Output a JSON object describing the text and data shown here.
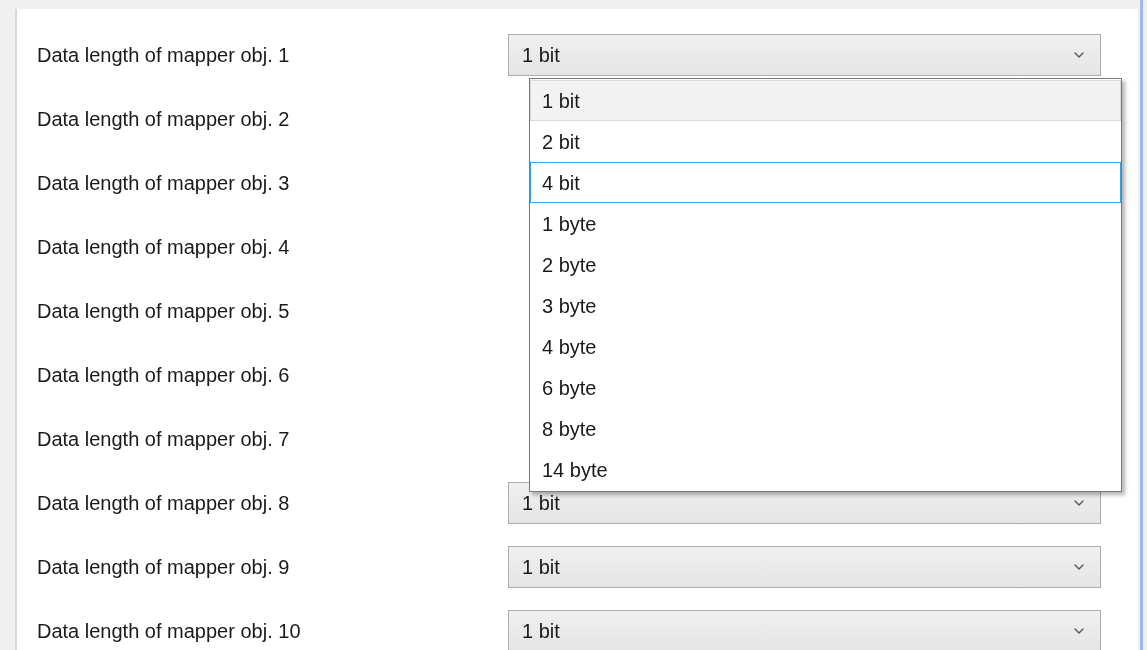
{
  "rows": [
    {
      "label": "Data length of mapper obj. 1",
      "value": "1 bit"
    },
    {
      "label": "Data length of mapper obj. 2"
    },
    {
      "label": "Data length of mapper obj. 3"
    },
    {
      "label": "Data length of mapper obj. 4"
    },
    {
      "label": "Data length of mapper obj. 5"
    },
    {
      "label": "Data length of mapper obj. 6"
    },
    {
      "label": "Data length of mapper obj. 7"
    },
    {
      "label": "Data length of mapper obj. 8",
      "value": "1 bit"
    },
    {
      "label": "Data length of mapper obj. 9",
      "value": "1 bit"
    },
    {
      "label": "Data length of mapper obj. 10",
      "value": "1 bit"
    }
  ],
  "dropdown": {
    "options": [
      {
        "label": "1 bit",
        "selected": true,
        "focused": false
      },
      {
        "label": "2 bit",
        "selected": false,
        "focused": false
      },
      {
        "label": "4 bit",
        "selected": false,
        "focused": true
      },
      {
        "label": "1 byte",
        "selected": false,
        "focused": false
      },
      {
        "label": "2 byte",
        "selected": false,
        "focused": false
      },
      {
        "label": "3 byte",
        "selected": false,
        "focused": false
      },
      {
        "label": "4 byte",
        "selected": false,
        "focused": false
      },
      {
        "label": "6 byte",
        "selected": false,
        "focused": false
      },
      {
        "label": "8 byte",
        "selected": false,
        "focused": false
      },
      {
        "label": "14 byte",
        "selected": false,
        "focused": false
      }
    ]
  }
}
